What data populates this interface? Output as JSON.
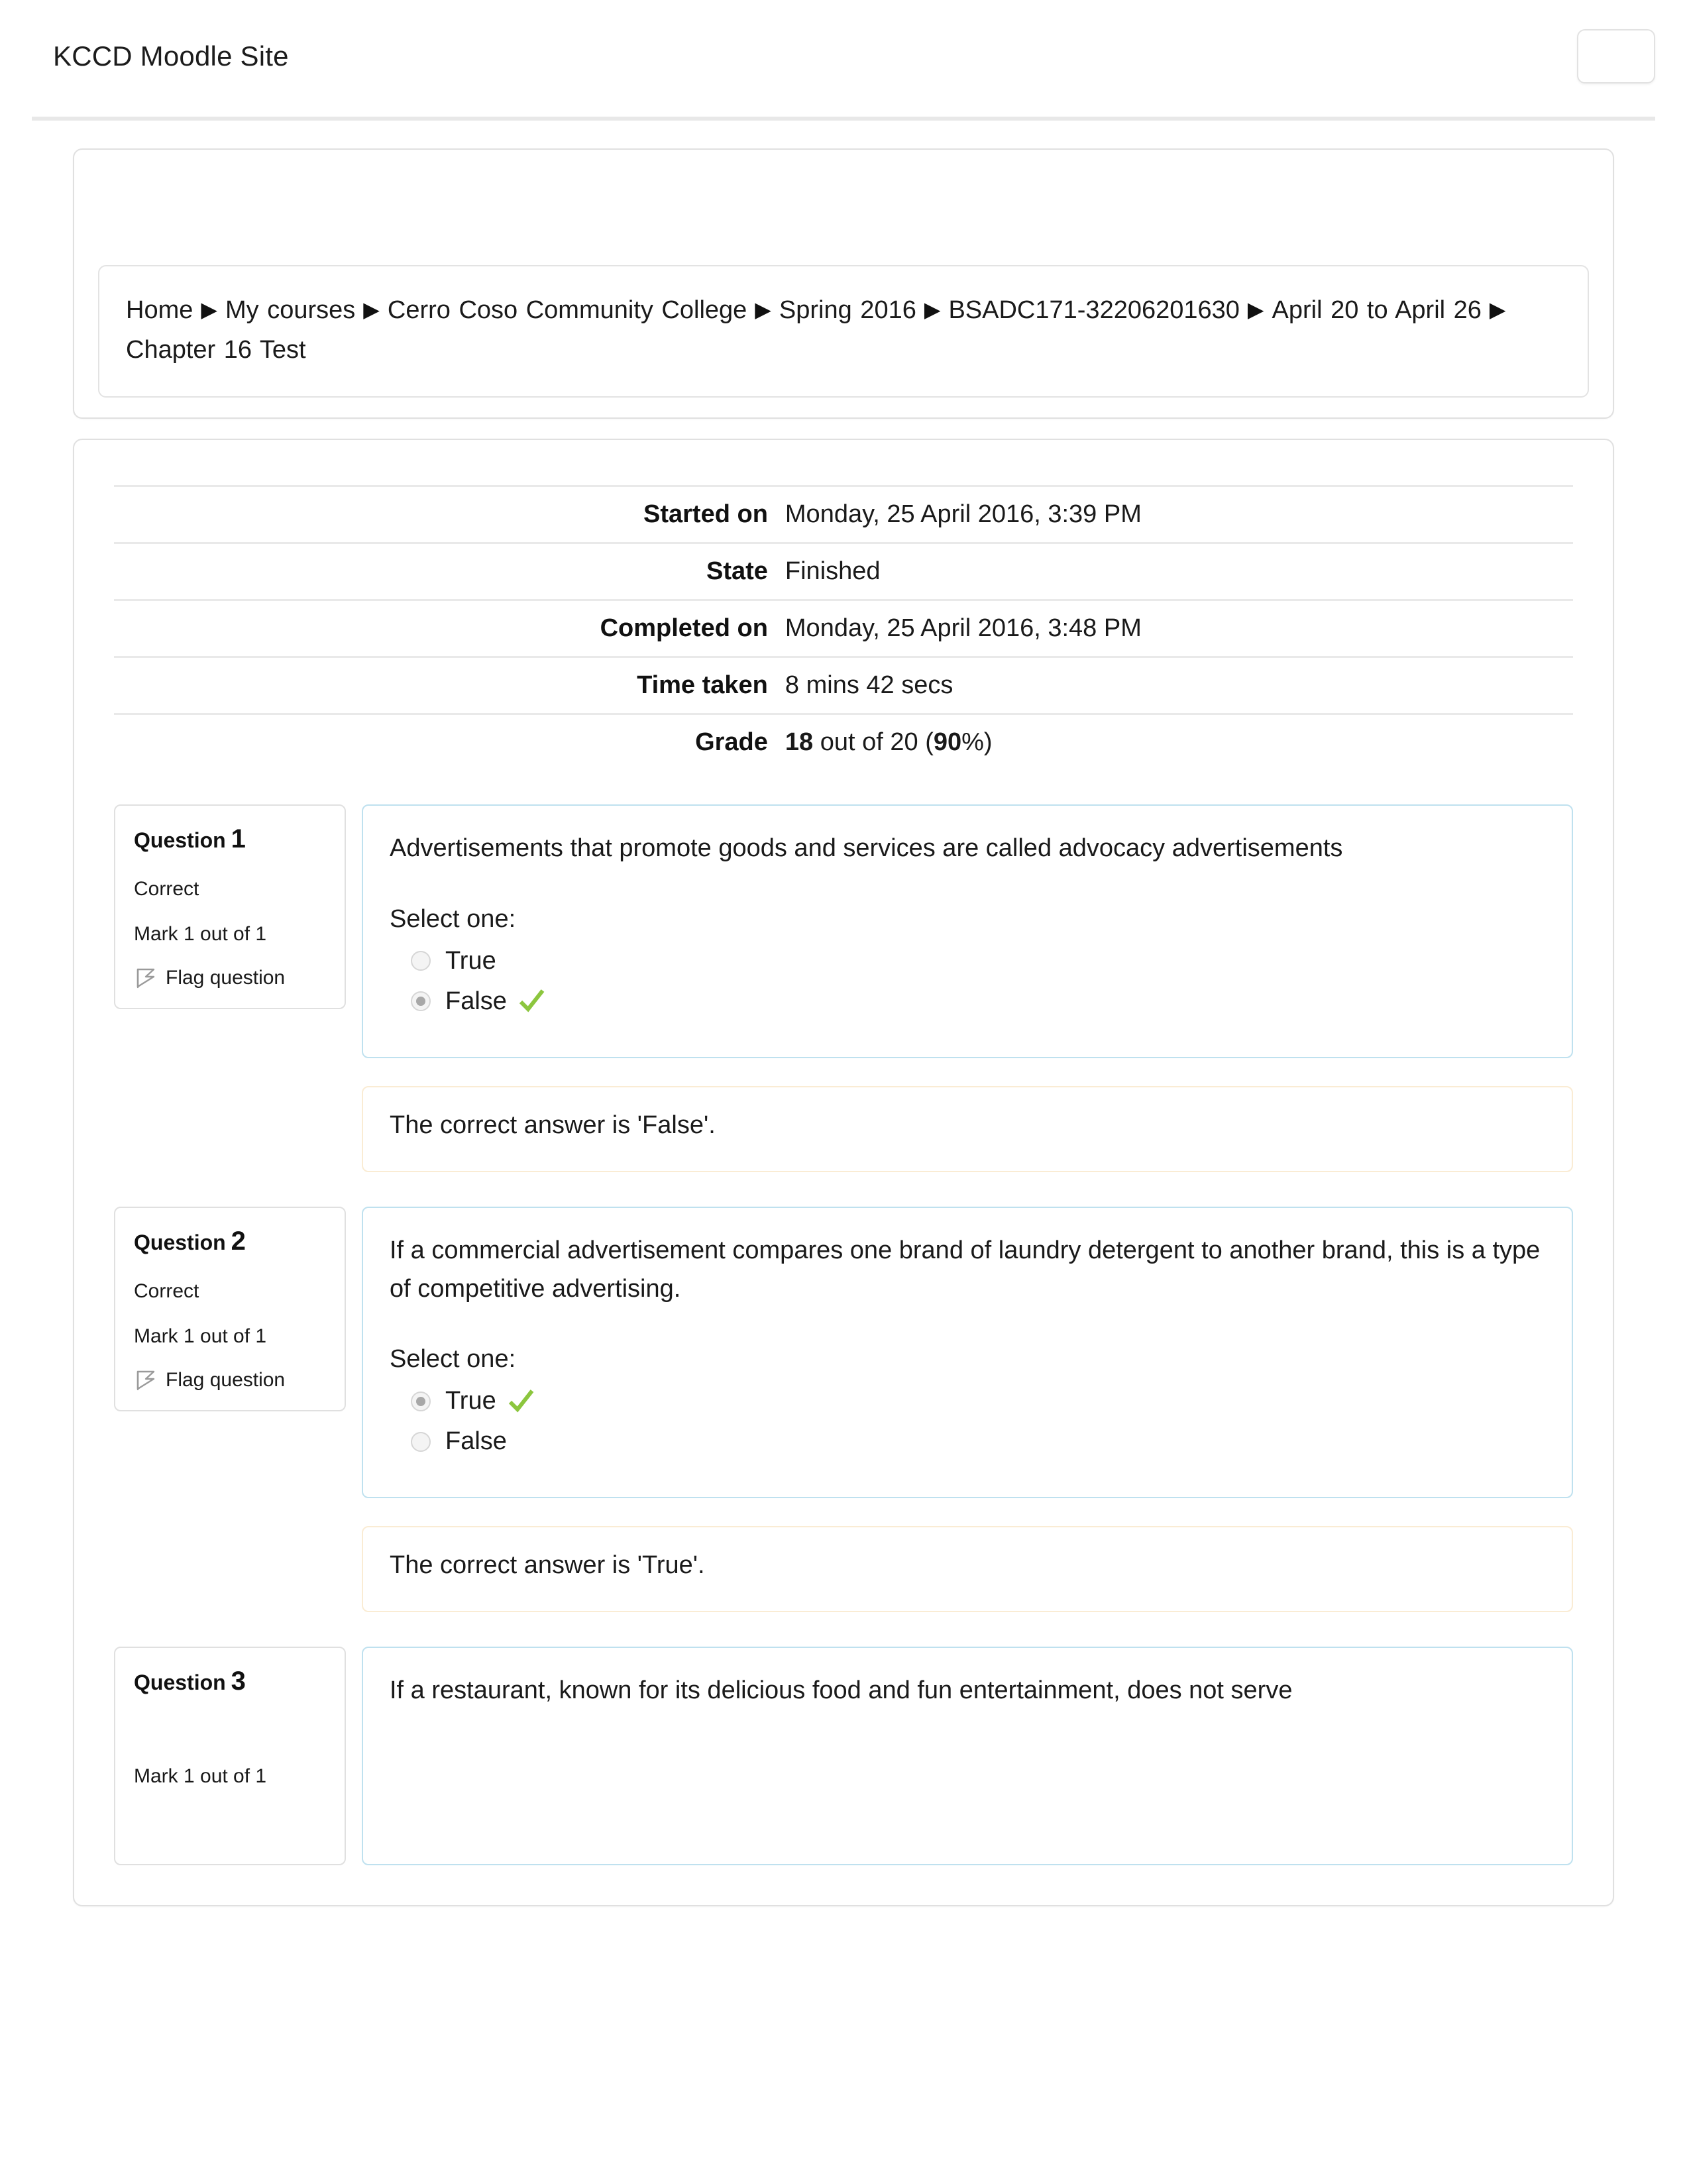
{
  "site": {
    "brand": "KCCD Moodle Site",
    "navbar_toggle_label": ""
  },
  "breadcrumb": {
    "separator": "▶",
    "items": [
      "Home",
      "My courses",
      "Cerro Coso Community College",
      "Spring 2016",
      "BSADC171-32206201630",
      "April 20 to April 26",
      "Chapter 16 Test"
    ]
  },
  "attempt_summary": {
    "rows": [
      {
        "label": "Started on",
        "value": "Monday, 25 April 2016, 3:39 PM"
      },
      {
        "label": "State",
        "value": "Finished"
      },
      {
        "label": "Completed on",
        "value": "Monday, 25 April 2016, 3:48 PM"
      },
      {
        "label": "Time taken",
        "value": "8 mins 42 secs"
      }
    ],
    "grade": {
      "label": "Grade",
      "score": "18",
      "middle": " out of 20 (",
      "percent": "90",
      "suffix": "%)"
    }
  },
  "flag_label": "Flag question",
  "select_one_label": "Select one:",
  "questions": [
    {
      "number_label": "Question",
      "number": "1",
      "state": "Correct",
      "mark": "Mark 1 out of 1",
      "flag": "Flag question",
      "text": "Advertisements that promote goods and services are called advocacy advertisements",
      "prompt": "Select one:",
      "options": [
        {
          "label": "True",
          "selected": false,
          "correct_tick": false
        },
        {
          "label": "False",
          "selected": true,
          "correct_tick": true
        }
      ],
      "feedback": "The correct answer is 'False'."
    },
    {
      "number_label": "Question",
      "number": "2",
      "state": "Correct",
      "mark": "Mark 1 out of 1",
      "flag": "Flag question",
      "text": "If a commercial advertisement compares one brand of laundry detergent to another brand, this is a type of competitive advertising.",
      "prompt": "Select one:",
      "options": [
        {
          "label": "True",
          "selected": true,
          "correct_tick": true
        },
        {
          "label": "False",
          "selected": false,
          "correct_tick": false
        }
      ],
      "feedback": "The correct answer is 'True'."
    },
    {
      "number_label": "Question",
      "number": "3",
      "state": "",
      "mark": "Mark 1 out of 1",
      "flag": "",
      "text": "If a restaurant, known for its delicious food and fun entertainment, does not serve",
      "prompt": "",
      "options": [],
      "feedback": ""
    }
  ],
  "colors": {
    "correct_tick": "#8cc63e",
    "question_border": "#bfe1ef",
    "feedback_border": "#faecd4",
    "card_border": "#e0e0e0",
    "rule_dark": "#2c2c2c"
  }
}
